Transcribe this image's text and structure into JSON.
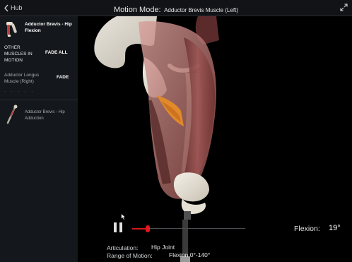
{
  "header": {
    "back_label": "Hub",
    "title": "Motion Mode:",
    "subtitle": "Adductor Brevis Muscle (Left)"
  },
  "sidebar": {
    "active_motion": "Adductor Brevis - Hip Flexion",
    "other_muscles_label": "OTHER MUSCLES IN MOTION",
    "fade_all_label": "FADE ALL",
    "muscles": [
      {
        "name": "Adductor Longus Muscle (Right)",
        "action": "FADE"
      }
    ],
    "more_indicator": "· · · · ·",
    "motions": [
      {
        "label": "Adductor Brevis - Hip Adduction"
      }
    ]
  },
  "playback": {
    "state": "paused",
    "angle_fraction": 0.136
  },
  "motion_info": {
    "flexion_label": "Flexion:",
    "flexion_value": "19°",
    "articulation_label": "Articulation:",
    "articulation_value": "Hip Joint",
    "range_label": "Range of Motion:",
    "range_value": "Flexion 0°-140°"
  },
  "colors": {
    "accent": "#e3171c",
    "header_bg": "#111316",
    "sidebar_bg": "#14171b",
    "highlight_muscle": "#e08a2c"
  }
}
